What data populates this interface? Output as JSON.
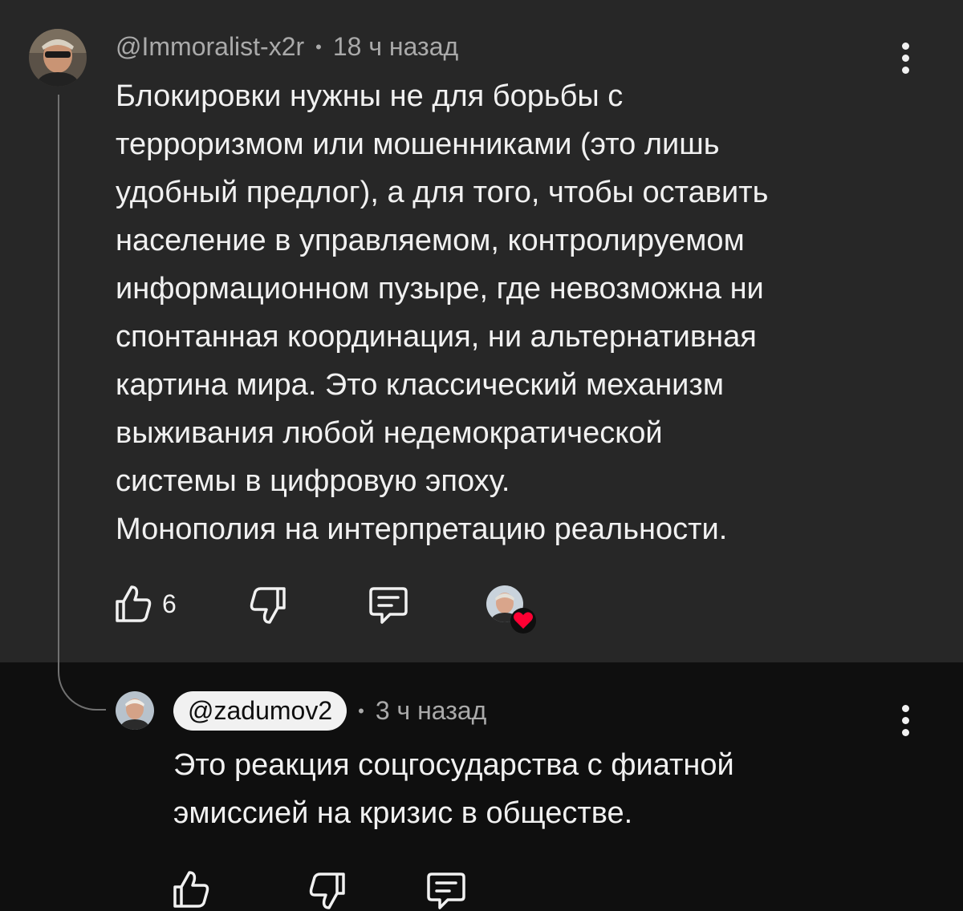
{
  "comment": {
    "author": "@Immoralist-x2r",
    "separator": "•",
    "time": "18 ч назад",
    "text": "Блокировки нужны не для борьбы с\nтерроризмом или мошенниками (это лишь\nудобный предлог), а для того, чтобы оставить\nнаселение в управляемом, контролируемом\nинформационном пузыре, где невозможна ни\nспонтанная координация, ни альтернативная\nкартина мира. Это классический механизм\nвыживания любой недемократической\nсистемы в цифровую эпоху.\nМонополия на интерпретацию реальности.",
    "likes": "6",
    "icons": [
      "thumbs-up-icon",
      "thumbs-down-icon",
      "reply-icon",
      "creator-heart-icon",
      "more-vert-icon"
    ]
  },
  "reply": {
    "author": "@zadumov2",
    "separator": "•",
    "time": "3 ч назад",
    "text": "Это реакция соцгосударства с фиатной\nэмиссией на кризис в обществе.",
    "icons": [
      "thumbs-up-icon",
      "thumbs-down-icon",
      "reply-icon",
      "more-vert-icon"
    ]
  },
  "colors": {
    "comment_bg": "#272727",
    "page_bg": "#0f0f0f",
    "text": "#f1f1f1",
    "meta": "#aaaaaa",
    "heart": "#ff0033"
  }
}
